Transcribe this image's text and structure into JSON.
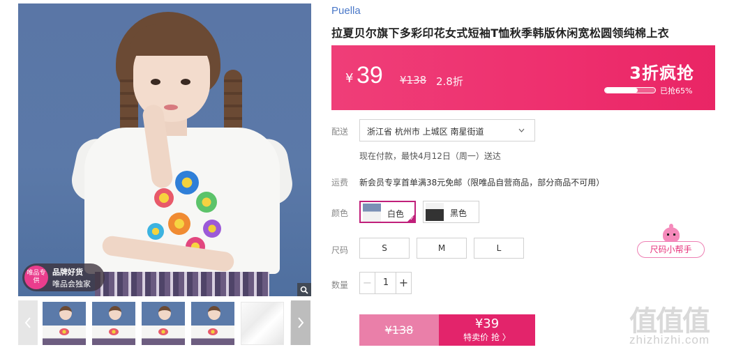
{
  "gallery": {
    "badge": {
      "circle_text": "唯品专供",
      "line1": "品牌好货",
      "line2": "唯品会独家"
    },
    "zoom_icon": "magnifier-icon",
    "prev_icon": "chevron-left-icon",
    "next_icon": "chevron-right-icon",
    "thumbnails": [
      "photo",
      "photo",
      "photo",
      "photo",
      "fabric",
      "partial"
    ]
  },
  "product": {
    "brand": "Puella",
    "title": "拉夏贝尔旗下多彩印花女式短袖T恤秋季韩版休闲宽松圆领纯棉上衣"
  },
  "price_banner": {
    "currency": "¥",
    "price": "39",
    "original": "¥138",
    "discount": "2.8折",
    "flash_label": "3折疯抢",
    "sold_progress": 0.65,
    "sold_label": "已抢65%"
  },
  "delivery": {
    "label": "配送",
    "address": "浙江省 杭州市 上城区 南星街道",
    "note": "现在付款，最快4月12日（周一）送达"
  },
  "shipping": {
    "label": "运费",
    "note": "新会员专享首单满38元免邮（限唯品自营商品，部分商品不可用）"
  },
  "colors": {
    "label": "颜色",
    "options": [
      {
        "name": "白色",
        "selected": true
      },
      {
        "name": "黑色",
        "selected": false
      }
    ]
  },
  "sizes": {
    "label": "尺码",
    "options": [
      "S",
      "M",
      "L"
    ],
    "helper": "尺码小帮手"
  },
  "quantity": {
    "label": "数量",
    "value": "1",
    "minus": "−",
    "plus": "+"
  },
  "buy": {
    "original_price": "¥138",
    "price": "¥39",
    "action": "特卖价 抢 〉"
  },
  "watermark": {
    "logo": "值值值",
    "url": "zhizhizhi.com"
  },
  "colors_palette": {
    "accent": "#ee2f6e",
    "buy_button": "#e3246b",
    "brand_link": "#4a78c8",
    "selected_border": "#c01f7a"
  }
}
